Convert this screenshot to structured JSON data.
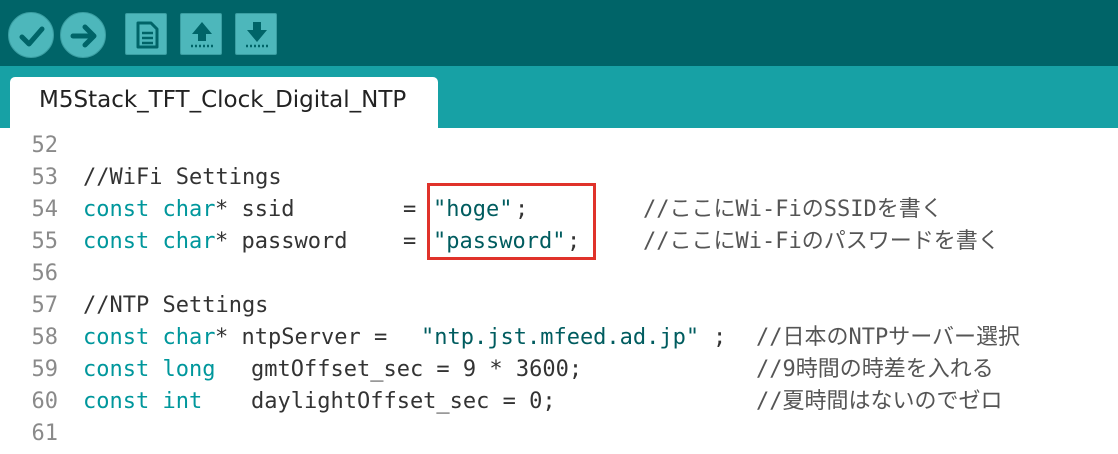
{
  "toolbar": {
    "buttons": [
      {
        "name": "verify",
        "icon": "check-icon"
      },
      {
        "name": "upload",
        "icon": "arrow-right-icon"
      },
      {
        "name": "new",
        "icon": "new-sketch-icon"
      },
      {
        "name": "open",
        "icon": "open-arrow-up-icon"
      },
      {
        "name": "save",
        "icon": "save-arrow-down-icon"
      }
    ]
  },
  "tab": {
    "label": "M5Stack_TFT_Clock_Digital_NTP"
  },
  "editor": {
    "lines": [
      {
        "number": "52",
        "parts": []
      },
      {
        "number": "53",
        "parts": [
          {
            "kind": "plain",
            "text": "//WiFi Settings"
          }
        ]
      },
      {
        "number": "54",
        "parts": [
          {
            "kind": "kw",
            "text": "const char"
          },
          {
            "kind": "plain",
            "text": "* ssid"
          },
          {
            "kind": "plain",
            "text": "="
          },
          {
            "kind": "str",
            "text": "\"hoge\""
          },
          {
            "kind": "plain",
            "text": ";"
          },
          {
            "kind": "cm",
            "text": "//ここにWi-FiのSSIDを書く"
          }
        ]
      },
      {
        "number": "55",
        "parts": [
          {
            "kind": "kw",
            "text": "const char"
          },
          {
            "kind": "plain",
            "text": "* password"
          },
          {
            "kind": "plain",
            "text": "="
          },
          {
            "kind": "str",
            "text": "\"password\""
          },
          {
            "kind": "plain",
            "text": ";"
          },
          {
            "kind": "cm",
            "text": "//ここにWi-Fiのパスワードを書く"
          }
        ]
      },
      {
        "number": "56",
        "parts": []
      },
      {
        "number": "57",
        "parts": [
          {
            "kind": "plain",
            "text": "//NTP Settings"
          }
        ]
      },
      {
        "number": "58",
        "parts": [
          {
            "kind": "kw",
            "text": "const char"
          },
          {
            "kind": "plain",
            "text": "* ntpServer = "
          },
          {
            "kind": "str",
            "text": "\"ntp.jst.mfeed.ad.jp\""
          },
          {
            "kind": "plain",
            "text": ";"
          },
          {
            "kind": "cm",
            "text": "//日本のNTPサーバー選択"
          }
        ]
      },
      {
        "number": "59",
        "parts": [
          {
            "kind": "kw",
            "text": "const long"
          },
          {
            "kind": "plain",
            "text": "gmtOffset_sec = 9 * 3600;"
          },
          {
            "kind": "cm",
            "text": "//9時間の時差を入れる"
          }
        ]
      },
      {
        "number": "60",
        "parts": [
          {
            "kind": "kw",
            "text": "const int"
          },
          {
            "kind": "plain",
            "text": "daylightOffset_sec = 0;"
          },
          {
            "kind": "cm",
            "text": "//夏時間はないのでゼロ"
          }
        ]
      },
      {
        "number": "61",
        "parts": []
      }
    ]
  },
  "colors": {
    "toolbar_bg": "#006468",
    "tabbar_bg": "#17a1a5",
    "button_bg": "#4db7bb",
    "keyword": "#00979c",
    "highlight_border": "#e0322a"
  }
}
